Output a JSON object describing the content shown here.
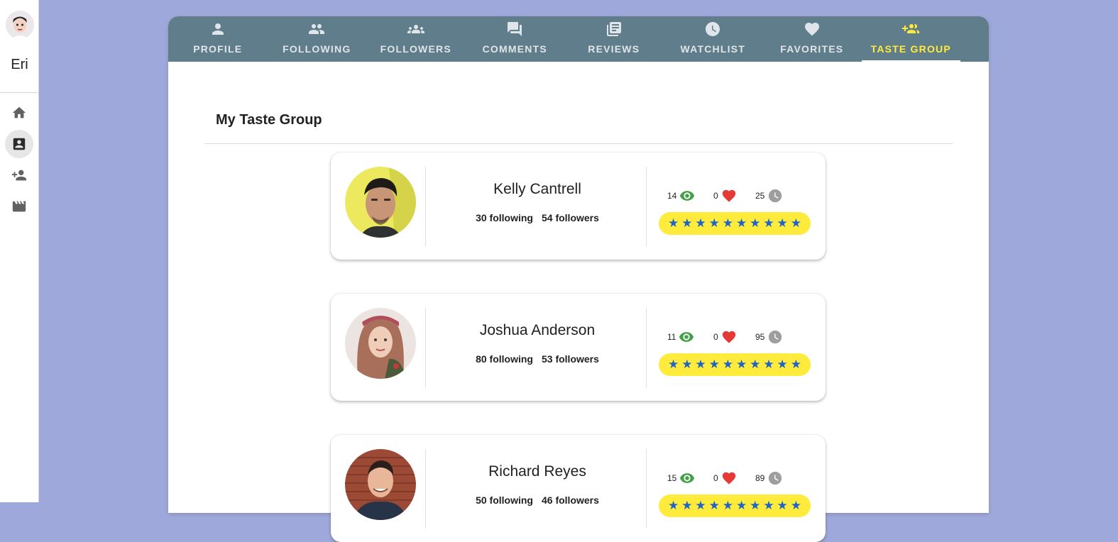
{
  "sidebar": {
    "user_name": "Eri",
    "items": [
      {
        "icon": "home-icon"
      },
      {
        "icon": "account-box-icon"
      },
      {
        "icon": "person-add-icon"
      },
      {
        "icon": "movie-icon"
      }
    ]
  },
  "tabs": [
    {
      "label": "PROFILE",
      "icon": "person-icon"
    },
    {
      "label": "FOLLOWING",
      "icon": "people-icon"
    },
    {
      "label": "FOLLOWERS",
      "icon": "groups-icon"
    },
    {
      "label": "COMMENTS",
      "icon": "forum-icon"
    },
    {
      "label": "REVIEWS",
      "icon": "library-books-icon"
    },
    {
      "label": "WATCHLIST",
      "icon": "clock-icon"
    },
    {
      "label": "FAVORITES",
      "icon": "heart-icon"
    },
    {
      "label": "TASTE GROUP",
      "icon": "group-add-icon",
      "active": true
    }
  ],
  "main": {
    "title": "My Taste Group",
    "members": [
      {
        "name": "Kelly Cantrell",
        "following": "30 following",
        "followers": "54 followers",
        "watched": "14",
        "favorites": "0",
        "watchlist": "25",
        "rating": 10,
        "max_rating": 10
      },
      {
        "name": "Joshua Anderson",
        "following": "80 following",
        "followers": "53 followers",
        "watched": "11",
        "favorites": "0",
        "watchlist": "95",
        "rating": 10,
        "max_rating": 10
      },
      {
        "name": "Richard Reyes",
        "following": "50 following",
        "followers": "46 followers",
        "watched": "15",
        "favorites": "0",
        "watchlist": "89",
        "rating": 10,
        "max_rating": 10
      }
    ]
  },
  "colors": {
    "background": "#9fa8da",
    "tabbar": "#607d8b",
    "accent": "#ffeb3b",
    "star": "#1e63c8",
    "eye": "#43a047",
    "heart": "#e53935",
    "clock": "#9e9e9e"
  }
}
